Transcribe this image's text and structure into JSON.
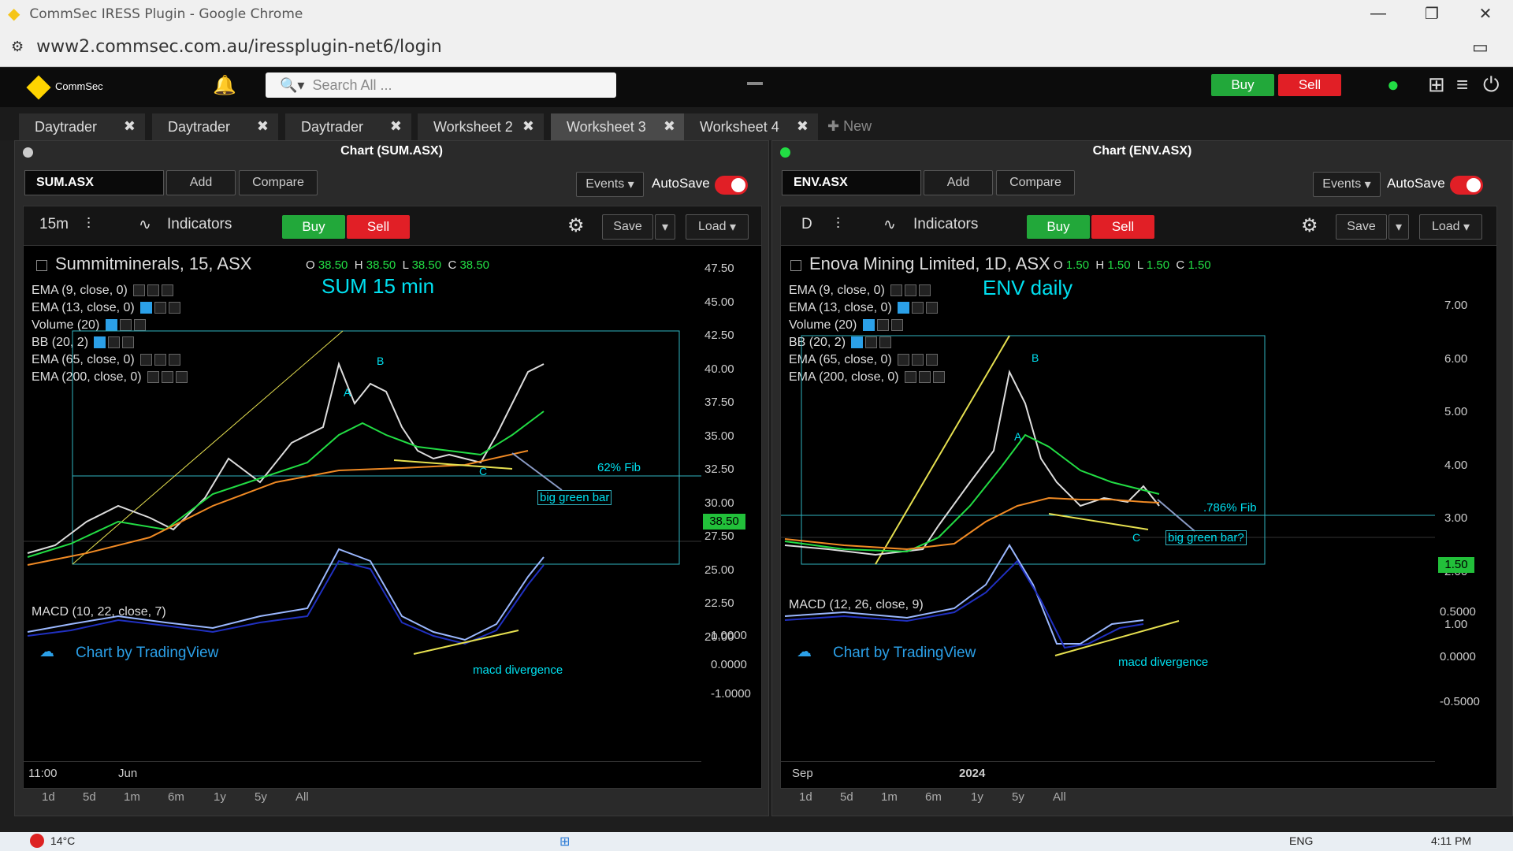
{
  "browser": {
    "title": "CommSec IRESS Plugin - Google Chrome",
    "url": "www2.commsec.com.au/iressplugin-net6/login"
  },
  "header": {
    "brand": "CommSec",
    "search_placeholder": "Search All ...",
    "buy_label": "Buy",
    "sell_label": "Sell"
  },
  "tabs": [
    {
      "label": "Daytrader"
    },
    {
      "label": "Daytrader"
    },
    {
      "label": "Daytrader"
    },
    {
      "label": "Worksheet 2"
    },
    {
      "label": "Worksheet 3"
    },
    {
      "label": "Worksheet 4"
    }
  ],
  "new_tab_label": "New",
  "panels": [
    {
      "title": "Chart (SUM.ASX)",
      "symbol": "SUM.ASX",
      "add_label": "Add",
      "compare_label": "Compare",
      "events_label": "Events",
      "autosave_label": "AutoSave",
      "interval": "15m",
      "indicators_label": "Indicators",
      "buy_label": "Buy",
      "sell_label": "Sell",
      "save_label": "Save",
      "load_label": "Load",
      "instrument": "Summitminerals, 15, ASX",
      "ohlc": {
        "o": "38.50",
        "h": "38.50",
        "l": "38.50",
        "c": "38.50"
      },
      "studies": [
        "EMA (9, close, 0)",
        "EMA (13, close, 0)",
        "Volume (20)",
        "BB (20, 2)",
        "EMA (65, close, 0)",
        "EMA (200, close, 0)"
      ],
      "macd": "MACD (10, 22, close, 7)",
      "tv_label": "Chart by TradingView",
      "annotation_title": "SUM 15 min",
      "annotation_fib": "62% Fib",
      "annotation_bar": "big green bar",
      "annotation_macd": "macd divergence",
      "wave_labels": [
        "A",
        "B",
        "C"
      ],
      "price_tag": "38.50",
      "y_ticks": [
        "47.50",
        "45.00",
        "42.50",
        "40.00",
        "37.50",
        "35.00",
        "32.50",
        "30.00",
        "27.50",
        "25.00",
        "22.50",
        "20.00"
      ],
      "macd_ticks": [
        "1.0000",
        "0.0000",
        "-1.0000"
      ],
      "x_labels": [
        "11:00",
        "Jun"
      ],
      "ranges": [
        "1d",
        "5d",
        "1m",
        "6m",
        "1y",
        "5y",
        "All"
      ]
    },
    {
      "title": "Chart (ENV.ASX)",
      "symbol": "ENV.ASX",
      "add_label": "Add",
      "compare_label": "Compare",
      "events_label": "Events",
      "autosave_label": "AutoSave",
      "interval": "D",
      "indicators_label": "Indicators",
      "buy_label": "Buy",
      "sell_label": "Sell",
      "save_label": "Save",
      "load_label": "Load",
      "instrument": "Enova Mining Limited, 1D, ASX",
      "ohlc": {
        "o": "1.50",
        "h": "1.50",
        "l": "1.50",
        "c": "1.50"
      },
      "studies": [
        "EMA (9, close, 0)",
        "EMA (13, close, 0)",
        "Volume (20)",
        "BB (20, 2)",
        "EMA (65, close, 0)",
        "EMA (200, close, 0)"
      ],
      "macd": "MACD (12, 26, close, 9)",
      "tv_label": "Chart by TradingView",
      "annotation_title": "ENV daily",
      "annotation_fib": ".786% Fib",
      "annotation_bar": "big green bar?",
      "annotation_macd": "macd divergence",
      "wave_labels": [
        "A",
        "B",
        "C"
      ],
      "price_tag": "1.50",
      "y_ticks": [
        "7.00",
        "6.00",
        "5.00",
        "4.00",
        "3.00",
        "2.00",
        "1.00"
      ],
      "macd_ticks": [
        "0.5000",
        "0.0000",
        "-0.5000"
      ],
      "x_labels": [
        "Sep",
        "2024"
      ],
      "ranges": [
        "1d",
        "5d",
        "1m",
        "6m",
        "1y",
        "5y",
        "All"
      ]
    }
  ],
  "taskbar": {
    "temp": "14°C",
    "lang": "ENG",
    "time": "4:11 PM"
  }
}
